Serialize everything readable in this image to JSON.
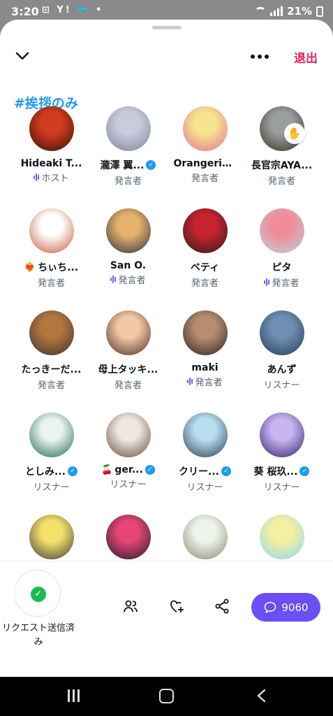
{
  "status_bar": {
    "time": "3:20",
    "notifications": "⊡ Y! 🐦 •",
    "battery": "21%"
  },
  "header": {
    "leave_label": "退出",
    "space_title": "#挨拶のみ"
  },
  "participants": [
    {
      "name": "Hideaki T...",
      "role": "ホスト",
      "verified": false,
      "emoji": "",
      "speaking": true,
      "hand": false,
      "avatar_colors": [
        "#d23b1e",
        "#3a0e06"
      ]
    },
    {
      "name": "瀧澤 翼...",
      "role": "発言者",
      "verified": true,
      "emoji": "",
      "speaking": false,
      "hand": false,
      "avatar_colors": [
        "#c8ccdb",
        "#7e84a3"
      ]
    },
    {
      "name": "Orangerie...",
      "role": "発言者",
      "verified": false,
      "emoji": "",
      "speaking": false,
      "hand": false,
      "avatar_colors": [
        "#f6e58d",
        "#e56f9a"
      ]
    },
    {
      "name": "長官宗AYA...",
      "role": "発言者",
      "verified": false,
      "emoji": "",
      "speaking": false,
      "hand": true,
      "avatar_colors": [
        "#9aa0a0",
        "#3f2f25"
      ]
    },
    {
      "name": "ちぃち...",
      "role": "発言者",
      "verified": false,
      "emoji": "❤️‍🔥",
      "speaking": false,
      "hand": false,
      "avatar_colors": [
        "#ffffff",
        "#c45a38"
      ]
    },
    {
      "name": "San O.",
      "role": "発言者",
      "verified": false,
      "emoji": "",
      "speaking": true,
      "hand": false,
      "avatar_colors": [
        "#e7b36a",
        "#2a2f45"
      ]
    },
    {
      "name": "ベティ",
      "role": "発言者",
      "verified": false,
      "emoji": "",
      "speaking": false,
      "hand": false,
      "avatar_colors": [
        "#c7232f",
        "#2b1c1c"
      ]
    },
    {
      "name": "ピタ",
      "role": "発言者",
      "verified": false,
      "emoji": "",
      "speaking": true,
      "hand": false,
      "avatar_colors": [
        "#f08c9a",
        "#b9d2d9"
      ]
    },
    {
      "name": "たっきーだ...",
      "role": "発言者",
      "verified": false,
      "emoji": "",
      "speaking": false,
      "hand": false,
      "avatar_colors": [
        "#b3763f",
        "#3b3230"
      ]
    },
    {
      "name": "母上タッキ...",
      "role": "発言者",
      "verified": false,
      "emoji": "",
      "speaking": false,
      "hand": false,
      "avatar_colors": [
        "#f1c9a6",
        "#4b2d1f"
      ]
    },
    {
      "name": "maki",
      "role": "発言者",
      "verified": false,
      "emoji": "",
      "speaking": true,
      "hand": false,
      "avatar_colors": [
        "#b68c72",
        "#2c2420"
      ]
    },
    {
      "name": "あんず",
      "role": "リスナー",
      "verified": false,
      "emoji": "",
      "speaking": false,
      "hand": false,
      "avatar_colors": [
        "#6e8fb3",
        "#263a55"
      ]
    },
    {
      "name": "としみ...",
      "role": "リスナー",
      "verified": true,
      "emoji": "",
      "speaking": false,
      "hand": false,
      "avatar_colors": [
        "#eaf2f2",
        "#1d6b4f"
      ]
    },
    {
      "name": "ger...",
      "role": "リスナー",
      "verified": true,
      "emoji": "🍒",
      "speaking": false,
      "hand": false,
      "avatar_colors": [
        "#efe8e2",
        "#6b4a36"
      ]
    },
    {
      "name": "クリー...",
      "role": "リスナー",
      "verified": true,
      "emoji": "",
      "speaking": false,
      "hand": false,
      "avatar_colors": [
        "#b8dff0",
        "#2d3e4d"
      ]
    },
    {
      "name": "葵 桜玖...",
      "role": "リスナー",
      "verified": true,
      "emoji": "",
      "speaking": false,
      "hand": false,
      "avatar_colors": [
        "#c7b6f2",
        "#34206b"
      ]
    },
    {
      "name": "",
      "role": "",
      "verified": false,
      "emoji": "",
      "speaking": false,
      "hand": false,
      "avatar_colors": [
        "#f5e06a",
        "#3a3a3a"
      ]
    },
    {
      "name": "",
      "role": "",
      "verified": false,
      "emoji": "",
      "speaking": false,
      "hand": false,
      "avatar_colors": [
        "#e64575",
        "#1c1c2c"
      ]
    },
    {
      "name": "",
      "role": "",
      "verified": false,
      "emoji": "",
      "speaking": false,
      "hand": false,
      "avatar_colors": [
        "#eef4ec",
        "#8c8a70"
      ]
    },
    {
      "name": "",
      "role": "",
      "verified": false,
      "emoji": "",
      "speaking": false,
      "hand": false,
      "avatar_colors": [
        "#f4f0a0",
        "#8fd6f0"
      ]
    }
  ],
  "bottom_bar": {
    "request_label": "リクエスト送信済み",
    "chat_count": "9060"
  },
  "colors": {
    "accent": "#1d9bf0",
    "leave": "#e0245e",
    "chat_button": "#6b4ef5",
    "speaking_wave": "#7856ff",
    "request_check": "#1db954"
  }
}
